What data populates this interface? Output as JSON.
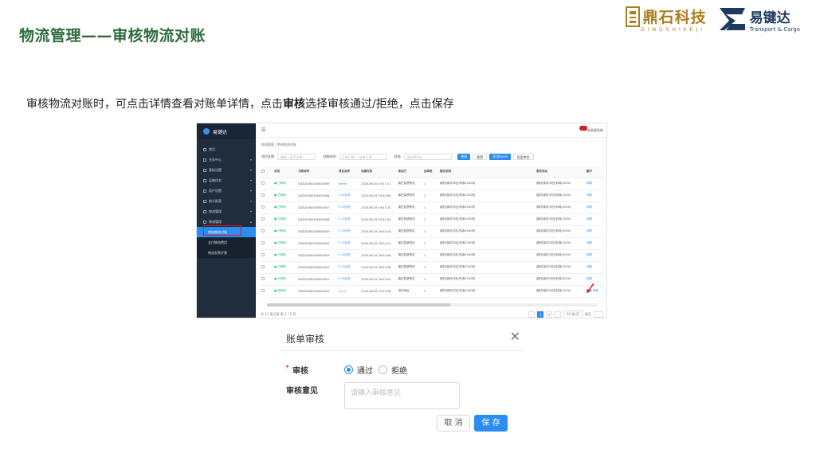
{
  "slide": {
    "title": "物流管理——审核物流对账",
    "intro_part1": "审核物流对账时，可点击详情查看对账单详情，点击",
    "intro_bold": "审核",
    "intro_part2": "选择审核通过/拒绝，点击保存"
  },
  "logos": {
    "dingshi_name": "鼎石科技",
    "dingshi_sub": "DINGSHIKEJI",
    "yijianda_name": "易键达",
    "yijianda_en": "Transport & Cargo"
  },
  "app": {
    "brand": "易键达",
    "menu": [
      {
        "label": "首页"
      },
      {
        "label": "业务中心"
      },
      {
        "label": "基础设置"
      },
      {
        "label": "运输任务"
      },
      {
        "label": "用户设置"
      },
      {
        "label": "统计报表"
      },
      {
        "label": "物流管理"
      },
      {
        "label": "物流管理"
      }
    ],
    "submenu": [
      {
        "label": "审核物流对账"
      },
      {
        "label": "支付物流费用"
      },
      {
        "label": "物流发票开票"
      }
    ],
    "topbar_user": "平安易顺系统",
    "breadcrumb": "物流管理 / 审核物流对账",
    "filters": {
      "project_label": "项目名称:",
      "project_placeholder": "请输入项目名称",
      "date_label": "对账时间:",
      "date_start": "开始日期",
      "date_end": "结束日期",
      "status_label": "状态:",
      "status_placeholder": "请选择状态",
      "search": "查询",
      "reset": "重置",
      "export": "导出Excel",
      "more": "批量审核"
    },
    "columns": [
      "状态",
      "对账单号",
      "项目名称",
      "创建时间",
      "承运方",
      "运单数",
      "服务说明",
      "服务地址",
      "操作"
    ],
    "rows": [
      {
        "status": "已审核",
        "no": "DZD20062500000009",
        "project": "name",
        "time": "2020-06-30 15:47:11",
        "carrier": "鼎石智慧物流",
        "count": "1",
        "desc": "钢材/废材/冲压/料卷1000吨",
        "addr": "钢材/废材/冲压/料卷(1000)",
        "op": "详情"
      },
      {
        "status": "已审核",
        "no": "DZD20062500000008",
        "project": "5.15业务",
        "time": "2020-06-29 19:59:06",
        "carrier": "鼎石智慧物流",
        "count": "1",
        "desc": "钢材/废材/冲压/料卷1000吨",
        "addr": "钢材/废材/冲压/料卷(1000)",
        "op": "详情"
      },
      {
        "status": "已审核",
        "no": "DZD20062500000007",
        "project": "5.15业务",
        "time": "2020-06-29 19:41:20",
        "carrier": "鼎石智慧物流",
        "count": "1",
        "desc": "钢材/废材/冲压/料卷1000吨",
        "addr": "钢材/废材/冲压/料卷(1000)",
        "op": "详情"
      },
      {
        "status": "已审核",
        "no": "DZD20062500000006",
        "project": "5.15业务",
        "time": "2020-06-29 19:41:02",
        "carrier": "鼎石智慧物流",
        "count": "1",
        "desc": "钢材/废材/冲压/料卷1000吨",
        "addr": "钢材/废材/冲压/料卷(1000)",
        "op": "详情"
      },
      {
        "status": "已审核",
        "no": "DZD20062500000005",
        "project": "5.15业务",
        "time": "2020-06-29 18:54:24",
        "carrier": "鼎石智慧物流",
        "count": "1",
        "desc": "钢材/废材/冲压/料卷1000吨",
        "addr": "钢材/废材/冲压/料卷(1000)",
        "op": "详情"
      },
      {
        "status": "已审核",
        "no": "DZD20062500000004",
        "project": "5.15业务",
        "time": "2020-06-29 18:54:14",
        "carrier": "鼎石智慧物流",
        "count": "1",
        "desc": "钢材/废材/冲压/料卷1000吨",
        "addr": "钢材/废材/冲压/料卷(1000)",
        "op": "详情"
      },
      {
        "status": "已审核",
        "no": "DZD20062500000003",
        "project": "5.15业务",
        "time": "2020-06-29 18:54:06",
        "carrier": "鼎石智慧物流",
        "count": "1",
        "desc": "钢材/废材/冲压/料卷1000吨",
        "addr": "钢材/废材/冲压/料卷(1000)",
        "op": "详情"
      },
      {
        "status": "已审核",
        "no": "DZD20062500000002",
        "project": "5.15业务",
        "time": "2020-06-29 18:53:58",
        "carrier": "鼎石智慧物流",
        "count": "1",
        "desc": "钢材/废材/冲压/料卷1000吨",
        "addr": "钢材/废材/冲压/料卷(1000)",
        "op": "详情"
      },
      {
        "status": "已审核",
        "no": "DZD20062500000001",
        "project": "5.15业务",
        "time": "2020-06-29 18:53:44",
        "carrier": "鼎石智慧物流",
        "count": "1",
        "desc": "钢材/废材/冲压/料卷1000吨",
        "addr": "钢材/废材/冲压/料卷(1000)",
        "op": "详情"
      },
      {
        "status": "待审核",
        "no": "DZD20062500000001",
        "project": "01-07",
        "time": "2020-06-09 15:53:36",
        "carrier": "测试承运",
        "count": "1",
        "desc": "钢材/废材/冲压/料卷1000吨",
        "addr": "钢材/废材/冲压/料卷(1000)",
        "op": "详情 审核"
      }
    ],
    "pager": {
      "total": "共 11 条记录 第 1 / 2 页",
      "pages": [
        "1",
        "2"
      ],
      "current": "1",
      "size": "10 条/页",
      "jump": "跳至"
    }
  },
  "dialog": {
    "title": "账单审核",
    "audit_label": "审核",
    "option_pass": "通过",
    "option_reject": "拒绝",
    "selected": "通过",
    "opinion_label": "审核意见",
    "opinion_placeholder": "请输入审核意见",
    "cancel": "取 消",
    "save": "保 存"
  },
  "colors": {
    "title_green": "#2e6b3e",
    "primary": "#2d8cf0",
    "sidebar": "#1f2d3d",
    "highlight_red": "#e0191a"
  }
}
